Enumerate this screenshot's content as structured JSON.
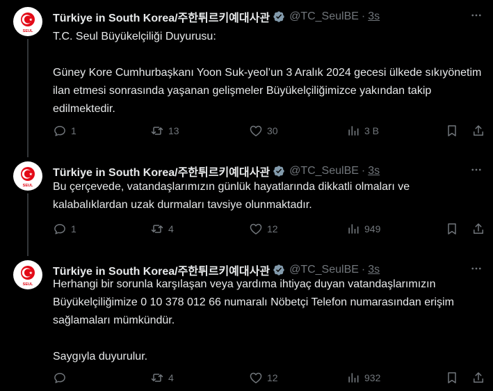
{
  "tweets": [
    {
      "author_name": "Türkiye in South Korea/주한튀르키예대사관",
      "handle": "@TC_SeulBE",
      "time": "3s",
      "paragraphs": [
        "T.C. Seul Büyükelçiliği Duyurusu:",
        "Güney Kore Cumhurbaşkanı Yoon Suk-yeol’un 3 Aralık 2024 gecesi ülkede sıkıyönetim ilan etmesi sonrasında yaşanan gelişmeler Büyükelçiliğimizce yakından takip edilmektedir."
      ],
      "replies": "1",
      "reposts": "13",
      "likes": "30",
      "views": "3 B"
    },
    {
      "author_name": "Türkiye in South Korea/주한튀르키예대사관",
      "handle": "@TC_SeulBE",
      "time": "3s",
      "paragraphs": [
        "Bu çerçevede, vatandaşlarımızın günlük hayatlarında dikkatli olmaları ve kalabalıklardan uzak durmaları tavsiye olunmaktadır."
      ],
      "replies": "1",
      "reposts": "4",
      "likes": "12",
      "views": "949"
    },
    {
      "author_name": "Türkiye in South Korea/주한튀르키예대사관",
      "handle": "@TC_SeulBE",
      "time": "3s",
      "paragraphs": [
        "Herhangi bir sorunla karşılaşan veya yardıma ihtiyaç duyan vatandaşlarımızın Büyükelçiliğimize 0 10 378 012 66  numaralı Nöbetçi Telefon numarasından erişim sağlamaları mümkündür.",
        "Saygıyla duyurulur."
      ],
      "replies": "",
      "reposts": "4",
      "likes": "12",
      "views": "932"
    }
  ],
  "avatar_text": "SEUL",
  "separator": "·",
  "colors": {
    "background": "#000000",
    "text": "#e7e9ea",
    "muted": "#71767b",
    "verified_badge": "#829aab",
    "flag_red": "#e30a17",
    "thread_line": "#333639"
  },
  "icons": [
    "reply-icon",
    "repost-icon",
    "like-icon",
    "views-icon",
    "bookmark-icon",
    "share-icon",
    "more-icon",
    "verified-badge-icon"
  ]
}
